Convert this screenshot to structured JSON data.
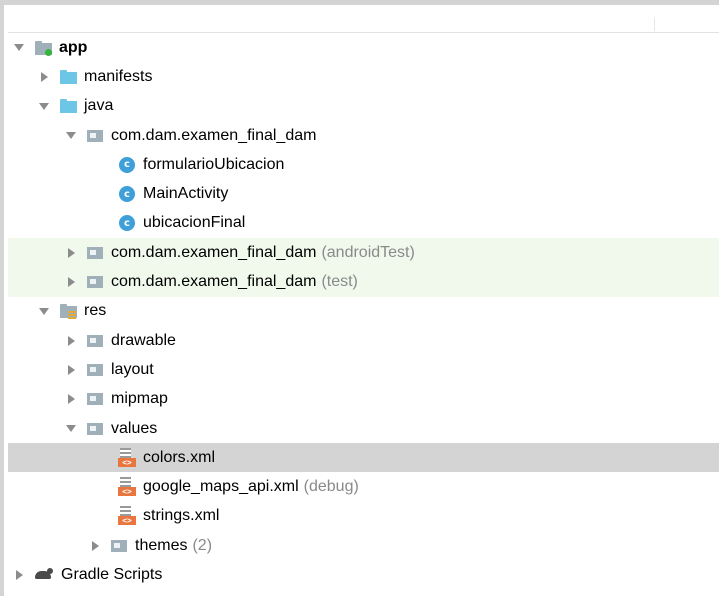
{
  "tree": {
    "app": "app",
    "manifests": "manifests",
    "java": "java",
    "pkg_main": "com.dam.examen_final_dam",
    "class1": "formularioUbicacion",
    "class2": "MainActivity",
    "class3": "ubicacionFinal",
    "pkg_android_test": "com.dam.examen_final_dam",
    "pkg_android_test_hint": "(androidTest)",
    "pkg_test": "com.dam.examen_final_dam",
    "pkg_test_hint": "(test)",
    "res": "res",
    "drawable": "drawable",
    "layout": "layout",
    "mipmap": "mipmap",
    "values": "values",
    "colors": "colors.xml",
    "google_maps": "google_maps_api.xml",
    "google_maps_hint": "(debug)",
    "strings": "strings.xml",
    "themes": "themes",
    "themes_hint": "(2)",
    "gradle": "Gradle Scripts"
  },
  "icons": {
    "xml_tag": "<>",
    "class_letter": "c"
  },
  "colors": {
    "selection": "#d4d4d4",
    "test_source_bg": "#f1f9ec",
    "class_icon": "#3f9fd8",
    "xml_icon": "#e9763f"
  }
}
